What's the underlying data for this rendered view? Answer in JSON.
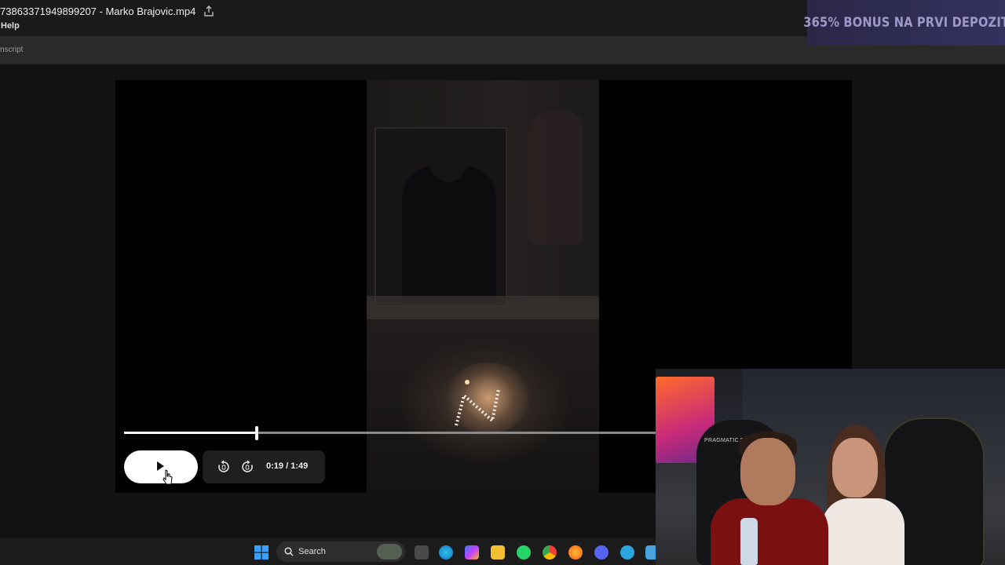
{
  "window": {
    "title": "7386337194989​9207 - Marko Brajovic.mp4",
    "menu_help": "Help",
    "subbar_text": "nscript"
  },
  "ad": {
    "text": "365% BONUS NA PRVI DEPOZIT",
    "color": "#9f99c9"
  },
  "player": {
    "current_time": "0:19",
    "duration": "/ 1:49",
    "progress": 0.174,
    "play_icon": "play-icon",
    "rewind_icon": "rewind-10-icon",
    "forward_icon": "forward-10-icon"
  },
  "taskbar": {
    "search_label": "Search",
    "icons": [
      "windows-icon",
      "search-icon",
      "widgets-icon",
      "task-view-icon",
      "edge-icon",
      "copilot-icon",
      "file-explorer-icon",
      "whatsapp-icon",
      "chrome-icon",
      "firefox-icon",
      "discord-icon",
      "telegram-icon",
      "notepad-icon"
    ]
  },
  "webcam": {
    "chair_brand": "PRAGMATIC PL"
  }
}
